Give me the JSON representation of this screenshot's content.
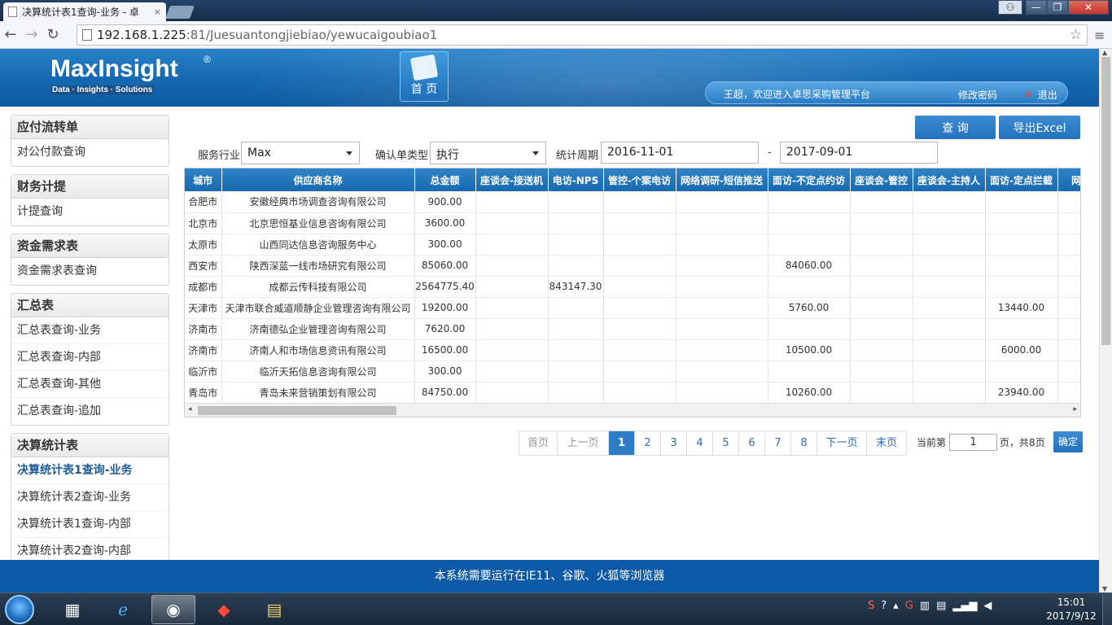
{
  "browser": {
    "tab_title": "决算统计表1查询-业务 - 卓",
    "tab_close": "×",
    "url_host": "192.168.1.225",
    "url_rest": ":81/Juesuantongjiebiao/yewucaigoubiao1",
    "window_min": "—",
    "window_max": "❐",
    "window_close": "✕"
  },
  "header": {
    "logo_name_a": "Max",
    "logo_name_b": "Insight",
    "logo_reg": "®",
    "logo_tagline": "Data · Insights · Solutions",
    "home_label": "首 页",
    "welcome": "王超，欢迎进入卓思采购管理平台",
    "change_password": "修改密码",
    "logout": "退出"
  },
  "sidebar": [
    {
      "title": "应付流转单",
      "items": [
        {
          "label": "对公付款查询"
        }
      ]
    },
    {
      "title": "财务计提",
      "items": [
        {
          "label": "计提查询"
        }
      ]
    },
    {
      "title": "资金需求表",
      "items": [
        {
          "label": "资金需求表查询"
        }
      ]
    },
    {
      "title": "汇总表",
      "items": [
        {
          "label": "汇总表查询-业务"
        },
        {
          "label": "汇总表查询-内部"
        },
        {
          "label": "汇总表查询-其他"
        },
        {
          "label": "汇总表查询-追加"
        }
      ]
    },
    {
      "title": "决算统计表",
      "items": [
        {
          "label": "决算统计表1查询-业务",
          "active": true
        },
        {
          "label": "决算统计表2查询-业务"
        },
        {
          "label": "决算统计表1查询-内部"
        },
        {
          "label": "决算统计表2查询-内部"
        }
      ]
    }
  ],
  "filters": {
    "industry_label": "服务行业",
    "industry_value": "Max",
    "confirm_type_label": "确认单类型",
    "confirm_type_value": "执行",
    "period_label": "统计周期",
    "period_start": "2016-11-01",
    "period_sep": "-",
    "period_end": "2017-09-01"
  },
  "actions": {
    "query": "查 询",
    "export": "导出Excel"
  },
  "table": {
    "columns": [
      "城市",
      "供应商名称",
      "总金额",
      "座谈会-接送机",
      "电访-NPS",
      "管控-个案电访",
      "网络调研-短信推送",
      "面访-不定点约访",
      "座谈会-管控",
      "座谈会-主持人",
      "面访-定点拦截",
      "网络"
    ],
    "rows": [
      [
        "合肥市",
        "安徽经典市场调查咨询有限公司",
        "900.00",
        "",
        "",
        "",
        "",
        "",
        "",
        "",
        "",
        ""
      ],
      [
        "北京市",
        "北京思恒基业信息咨询有限公司",
        "3600.00",
        "",
        "",
        "",
        "",
        "",
        "",
        "",
        "",
        ""
      ],
      [
        "太原市",
        "山西同达信息咨询服务中心",
        "300.00",
        "",
        "",
        "",
        "",
        "",
        "",
        "",
        "",
        ""
      ],
      [
        "西安市",
        "陕西深蓝一线市场研究有限公司",
        "85060.00",
        "",
        "",
        "",
        "",
        "84060.00",
        "",
        "",
        "",
        ""
      ],
      [
        "成都市",
        "成都云传科技有限公司",
        "2564775.40",
        "",
        "843147.30",
        "",
        "",
        "",
        "",
        "",
        "",
        ""
      ],
      [
        "天津市",
        "天津市联合威道顺静企业管理咨询有限公司",
        "19200.00",
        "",
        "",
        "",
        "",
        "5760.00",
        "",
        "",
        "13440.00",
        ""
      ],
      [
        "济南市",
        "济南德弘企业管理咨询有限公司",
        "7620.00",
        "",
        "",
        "",
        "",
        "",
        "",
        "",
        "",
        ""
      ],
      [
        "济南市",
        "济南人和市场信息资讯有限公司",
        "16500.00",
        "",
        "",
        "",
        "",
        "10500.00",
        "",
        "",
        "6000.00",
        ""
      ],
      [
        "临沂市",
        "临沂天拓信息咨询有限公司",
        "300.00",
        "",
        "",
        "",
        "",
        "",
        "",
        "",
        "",
        ""
      ],
      [
        "青岛市",
        "青岛未来营销策划有限公司",
        "84750.00",
        "",
        "",
        "",
        "",
        "10260.00",
        "",
        "",
        "23940.00",
        ""
      ]
    ]
  },
  "pager": {
    "first": "首页",
    "prev": "上一页",
    "pages": [
      "1",
      "2",
      "3",
      "4",
      "5",
      "6",
      "7",
      "8"
    ],
    "current": "1",
    "next": "下一页",
    "last": "末页",
    "current_label": "当前第",
    "input_value": "1",
    "total_text": "页，共8页",
    "confirm": "确定"
  },
  "footer": {
    "notice": "本系统需要运行在IE11、谷歌、火狐等浏览器"
  },
  "taskbar": {
    "time": "15:01",
    "date": "2017/9/12"
  }
}
